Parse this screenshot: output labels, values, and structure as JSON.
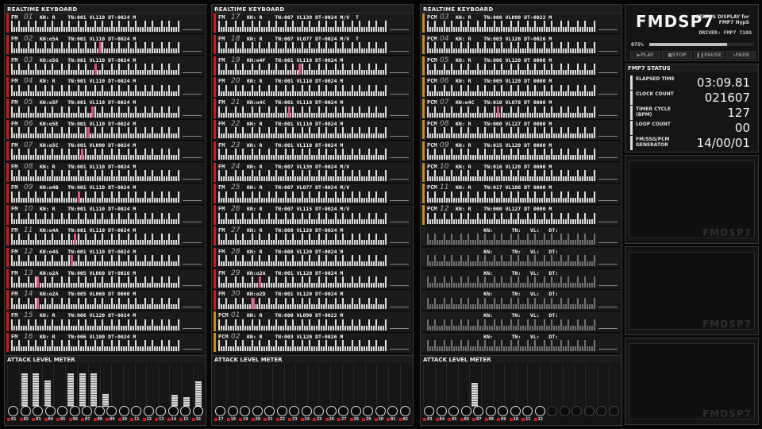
{
  "columns": [
    {
      "header": "REALTIME KEYBOARD",
      "meter_title": "ATTACK LEVEL METER",
      "rows": [
        {
          "type": "FM",
          "num": "01",
          "text": "KN: R    TN:001 VL110 DT-0024 M",
          "hits": []
        },
        {
          "type": "FM",
          "num": "02",
          "text": "KN:o5A   TN:001 VL110 DT-0024 M",
          "hits": [
            0.52
          ]
        },
        {
          "type": "FM",
          "num": "03",
          "text": "KN:o5G   TN:001 VL110 DT-0024 M",
          "hits": [
            0.49
          ]
        },
        {
          "type": "FM",
          "num": "04",
          "text": "KN: R    TN:001 VL110 DT-0024 M",
          "hits": []
        },
        {
          "type": "FM",
          "num": "05",
          "text": "KN:o5F   TN:001 VL110 DT-0024 M",
          "hits": [
            0.47
          ]
        },
        {
          "type": "FM",
          "num": "06",
          "text": "KN:o5E   TN:001 VL110 DT-0024 M",
          "hits": [
            0.45
          ]
        },
        {
          "type": "FM",
          "num": "07",
          "text": "KN:o5C   TN:001 VL090 DT-0024 M",
          "hits": [
            0.41
          ]
        },
        {
          "type": "FM",
          "num": "08",
          "text": "KN: R    TN:001 VL110 DT-0024 M",
          "hits": []
        },
        {
          "type": "FM",
          "num": "09",
          "text": "KN:o4B   TN:001 VL110 DT-0024 M",
          "hits": [
            0.39
          ]
        },
        {
          "type": "FM",
          "num": "10",
          "text": "KN: R    TN:001 VL110 DT-0024 M",
          "hits": []
        },
        {
          "type": "FM",
          "num": "11",
          "text": "KN:o4A   TN:001 VL110 DT-0024 M",
          "hits": [
            0.37
          ]
        },
        {
          "type": "FM",
          "num": "12",
          "text": "KN:o4G   TN:001 VL110 DT-0024 M",
          "hits": [
            0.35
          ]
        },
        {
          "type": "FM",
          "num": "13",
          "text": "KN:o2A   TN:005 VL060 DT-0016 M",
          "hits": [
            0.15
          ]
        },
        {
          "type": "FM",
          "num": "14",
          "text": "KN:o2A   TN:005 VL060 DT 0000 M",
          "hits": [
            0.15
          ]
        },
        {
          "type": "FM",
          "num": "15",
          "text": "KN: R    TN:006 VL120 DT-0024 M",
          "hits": []
        },
        {
          "type": "FM",
          "num": "16",
          "text": "KN: R    TN:006 VL100 DT-0024 M",
          "hits": []
        }
      ],
      "meters": [
        0,
        0.78,
        0.78,
        0.62,
        0,
        0.78,
        0.78,
        0.78,
        0.3,
        0,
        0,
        0,
        0,
        0,
        0.28,
        0.22,
        0.6
      ],
      "channel_labels": [
        "01",
        "02",
        "03",
        "04",
        "05",
        "06",
        "07",
        "08",
        "09",
        "10",
        "11",
        "12",
        "13",
        "14",
        "15",
        "16"
      ]
    },
    {
      "header": "REALTIME KEYBOARD",
      "meter_title": "ATTACK LEVEL METER",
      "rows": [
        {
          "type": "FM",
          "num": "17",
          "text": "KN: R    TN:007 VL139 DT-0024 M/V  T",
          "hits": []
        },
        {
          "type": "FM",
          "num": "18",
          "text": "KN: R    TN:007 VL077 DT-0024 M/V  T",
          "hits": []
        },
        {
          "type": "FM",
          "num": "19",
          "text": "KN:o4F   TN:001 VL110 DT-0024 M",
          "hits": [
            0.47
          ]
        },
        {
          "type": "FM",
          "num": "20",
          "text": "KN: R    TN:001 VL110 DT-0024 M",
          "hits": []
        },
        {
          "type": "FM",
          "num": "21",
          "text": "KN:o4C   TN:001 VL110 DT-0024 M",
          "hits": [
            0.41
          ]
        },
        {
          "type": "FM",
          "num": "22",
          "text": "KN: R    TN:001 VL110 DT-0024 M",
          "hits": []
        },
        {
          "type": "FM",
          "num": "23",
          "text": "KN: R    TN:001 VL110 DT-0024 M",
          "hits": []
        },
        {
          "type": "FM",
          "num": "24",
          "text": "KN: R    TN:007 VL139 DT-0024 M/V",
          "hits": []
        },
        {
          "type": "FM",
          "num": "25",
          "text": "KN: R    TN:007 VL077 DT-0024 M/V",
          "hits": []
        },
        {
          "type": "FM",
          "num": "26",
          "text": "KN: R    TN:007 VL115 DT-0024 M/V",
          "hits": []
        },
        {
          "type": "FM",
          "num": "27",
          "text": "KN: R    TN:008 VL120 DT-0024 M",
          "hits": []
        },
        {
          "type": "FM",
          "num": "28",
          "text": "KN: R    TN:008 VL120 DT-0024 M",
          "hits": []
        },
        {
          "type": "FM",
          "num": "29",
          "text": "KN:o2A   TN:001 VL120 DT-0024 M",
          "hits": [
            0.24
          ]
        },
        {
          "type": "FM",
          "num": "30",
          "text": "KN:o2D   TN:001 VL120 DT-0024 M",
          "hits": [
            0.2
          ]
        },
        {
          "type": "PCM",
          "num": "01",
          "text": "KN: R    TN:000 VL090 DT-0022 M",
          "hits": []
        },
        {
          "type": "PCM",
          "num": "02",
          "text": "KN: R    TN:003 VL120 DT-0026 M",
          "hits": []
        }
      ],
      "meters": [
        0,
        0,
        0,
        0,
        0,
        0,
        0,
        0,
        0,
        0,
        0,
        0,
        0,
        0,
        0,
        0,
        0
      ],
      "channel_labels": [
        "17",
        "18",
        "19",
        "20",
        "21",
        "22",
        "23",
        "24",
        "25",
        "26",
        "27",
        "28",
        "29",
        "30",
        "01",
        "02"
      ]
    },
    {
      "header": "REALTIME KEYBOARD",
      "meter_title": "ATTACK LEVEL METER",
      "rows": [
        {
          "type": "PCM",
          "num": "03",
          "text": "KN: R    TN:000 VL090 DT-0022 M",
          "hits": []
        },
        {
          "type": "PCM",
          "num": "04",
          "text": "KN: R    TN:003 VL120 DT-0026 M",
          "hits": []
        },
        {
          "type": "PCM",
          "num": "05",
          "text": "KN: R    TN:006 VL120 DT 0000 M",
          "hits": []
        },
        {
          "type": "PCM",
          "num": "06",
          "text": "KN: R    TN:009 VL120 DT 0000 M",
          "hits": []
        },
        {
          "type": "PCM",
          "num": "07",
          "text": "KN:o4C   TN:010 VL078 DT 0000 M",
          "hits": [
            0.41
          ]
        },
        {
          "type": "PCM",
          "num": "08",
          "text": "KN: R    TN:000 VL127 DT 0000 M",
          "hits": []
        },
        {
          "type": "PCM",
          "num": "09",
          "text": "KN: R    TN:015 VL120 DT 0000 M",
          "hits": []
        },
        {
          "type": "PCM",
          "num": "10",
          "text": "KN: R    TN:016 VL120 DT 0000 M",
          "hits": []
        },
        {
          "type": "PCM",
          "num": "11",
          "text": "KN: R    TN:017 VL106 DT 0000 M",
          "hits": []
        },
        {
          "type": "PCM",
          "num": "12",
          "text": "KN: R    TN:000 VL127 DT 0000 M",
          "hits": []
        },
        {
          "type": "",
          "num": "",
          "text": "         KN:      TN:   VL:   DT:",
          "hits": []
        },
        {
          "type": "",
          "num": "",
          "text": "         KN:      TN:   VL:   DT:",
          "hits": []
        },
        {
          "type": "",
          "num": "",
          "text": "         KN:      TN:   VL:   DT:",
          "hits": []
        },
        {
          "type": "",
          "num": "",
          "text": "         KN:      TN:   VL:   DT:",
          "hits": []
        },
        {
          "type": "",
          "num": "",
          "text": "         KN:      TN:   VL:   DT:",
          "hits": []
        },
        {
          "type": "",
          "num": "",
          "text": "         KN:      TN:   VL:   DT:",
          "hits": []
        }
      ],
      "meters": [
        0,
        0,
        0,
        0,
        0.55,
        0,
        0,
        0,
        0,
        0,
        0,
        0,
        0,
        0,
        0,
        0,
        0
      ],
      "channel_labels": [
        "03",
        "04",
        "05",
        "06",
        "07",
        "08",
        "09",
        "10",
        "11",
        "12"
      ]
    }
  ],
  "status": {
    "logo": "FMDSP7",
    "logo_sub": "STATUS DISPLAY for FMP7 HypS",
    "driver": "DRIVER: FMP7 710G",
    "progress_label": "075%",
    "progress": 0.75,
    "buttons": [
      "▶PLAY",
      "■STOP",
      "❚❚PAUSE",
      "↘FADE"
    ],
    "title": "FMP7 STATUS",
    "items": [
      {
        "label": "ELAPSED TIME",
        "value": "03:09.81"
      },
      {
        "label": "CLOCK COUNT",
        "value": "021607"
      },
      {
        "label": "TIMER CYCLE (BPM)",
        "value": "127"
      },
      {
        "label": "LOOP COUNT",
        "value": "00"
      },
      {
        "label": "FM/SSG/PCM GENERATOR",
        "value": "14/00/01"
      }
    ],
    "watermark": "FMDSP7"
  }
}
